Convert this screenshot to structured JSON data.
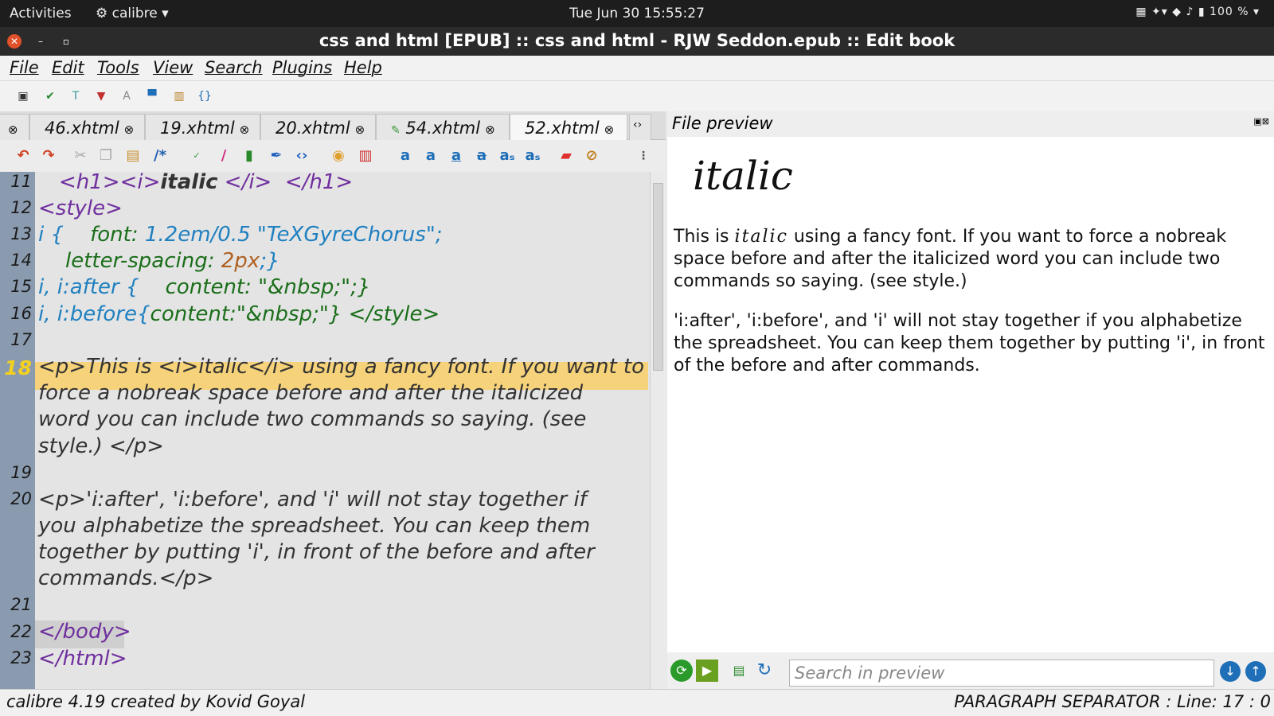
{
  "topbar": {
    "activities": "Activities",
    "app": "calibre",
    "clock": "Tue Jun 30  15:55:27",
    "tray": "100 %"
  },
  "window": {
    "title": "css and html [EPUB] :: css and html - RJW Seddon.epub :: Edit book"
  },
  "menu": [
    "File",
    "Edit",
    "Tools",
    "View",
    "Search",
    "Plugins",
    "Help"
  ],
  "tabs": [
    "46.xhtml",
    "19.xhtml",
    "20.xhtml",
    "54.xhtml",
    "52.xhtml"
  ],
  "lines": [
    "11",
    "12",
    "13",
    "14",
    "15",
    "16",
    "17",
    "18",
    "19",
    "20",
    "21",
    "22",
    "23"
  ],
  "code": {
    "l11a": "<h1><i>",
    "l11b": "italic",
    "l11c": " </i>  </h1>",
    "l12": "<style>",
    "l13a": "i { ",
    "l13b": "font: ",
    "l13c": "1.2em/0.5 \"TeXGyreChorus\";",
    "l14a": "letter-spacing: ",
    "l14b": "2px",
    "l14c": ";}",
    "l15a": "i, i:after { ",
    "l15b": "content: \"&nbsp;\";}",
    "l16a": "i, i:before{",
    "l16b": "content:\"&nbsp;\"} </style>",
    "l18a": "<p>This is <i>italic</i> using a fancy font. If you want to",
    "l18b": "force a nobreak space before and after the italicized",
    "l18c": "word you can include two commands so saying. (see",
    "l18d": "style.) </p>",
    "l20a": "<p>'i:after', 'i:before', and 'i' will not stay together if",
    "l20b": "you alphabetize the spreadsheet. You can keep them",
    "l20c": "together by putting 'i', in front of the before and after",
    "l20d": "commands.</p>",
    "l22": "</body>",
    "l23": "</html>"
  },
  "preview": {
    "header": "File preview",
    "heading": "italic",
    "p1_before": "This is ",
    "p1_italic": "italic",
    "p1_after": " using a fancy font. If you want to force a nobreak space before and after the italicized word you can include two commands so saying. (see style.)",
    "p2": "'i:after', 'i:before', and 'i' will not stay together if you alphabetize the spreadsheet. You can keep them together by putting 'i', in front of the before and after commands.",
    "search_placeholder": "Search in preview"
  },
  "status": {
    "left": "calibre 4.19 created by Kovid Goyal",
    "right": "PARAGRAPH SEPARATOR : Line: 17 : 0"
  }
}
